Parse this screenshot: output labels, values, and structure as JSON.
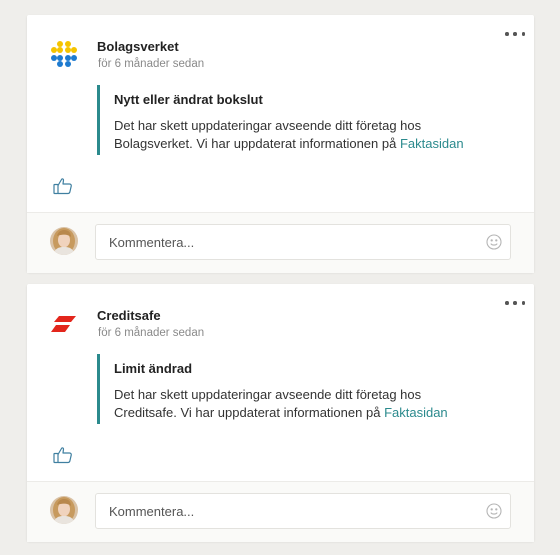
{
  "posts": [
    {
      "org_name": "Bolagsverket",
      "timestamp": "för 6 månader sedan",
      "logo_icon": "bolagsverket-dots-logo",
      "logo_colors": [
        "#f5c400",
        "#1e7bd0"
      ],
      "update_title": "Nytt eller ändrat bokslut",
      "update_text_line1": "Det har skett uppdateringar avseende ditt företag hos",
      "update_text_line2": "Bolagsverket. Vi har uppdaterat informationen på",
      "link_text": "Faktasidan",
      "comment_placeholder": "Kommentera..."
    },
    {
      "org_name": "Creditsafe",
      "timestamp": "för 6 månader sedan",
      "logo_icon": "creditsafe-red-stripes-logo",
      "logo_colors": [
        "#e3261c"
      ],
      "update_title": "Limit ändrad",
      "update_text_line1": "Det har skett uppdateringar avseende ditt företag hos",
      "update_text_line2": "Creditsafe. Vi har uppdaterat informationen på",
      "link_text": "Faktasidan",
      "comment_placeholder": "Kommentera..."
    }
  ],
  "accent_color": "#2b8a8d",
  "icons": {
    "menu": "more-options-icon",
    "like": "thumbs-up-icon",
    "emoji": "smiley-icon",
    "avatar": "user-avatar"
  }
}
